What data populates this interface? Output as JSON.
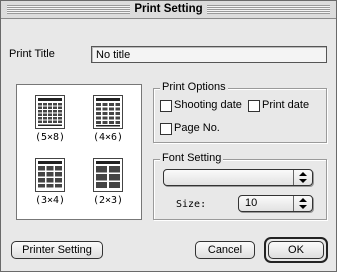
{
  "window": {
    "title": "Print Setting"
  },
  "print_title": {
    "label": "Print Title",
    "value": "No title"
  },
  "layouts": [
    {
      "caption": "(5×8)",
      "icon": "layout-5x8-icon"
    },
    {
      "caption": "(4×6)",
      "icon": "layout-4x6-icon"
    },
    {
      "caption": "(3×4)",
      "icon": "layout-3x4-icon"
    },
    {
      "caption": "(2×3)",
      "icon": "layout-2x3-icon"
    }
  ],
  "print_options": {
    "title": "Print Options",
    "shooting_date": {
      "label": "Shooting date",
      "checked": false
    },
    "print_date": {
      "label": "Print date",
      "checked": false
    },
    "page_no": {
      "label": "Page No.",
      "checked": false
    }
  },
  "font_setting": {
    "title": "Font Setting",
    "font_value": "",
    "size_label": "Size:",
    "size_value": "10"
  },
  "buttons": {
    "printer_setting": "Printer Setting",
    "cancel": "Cancel",
    "ok": "OK"
  }
}
